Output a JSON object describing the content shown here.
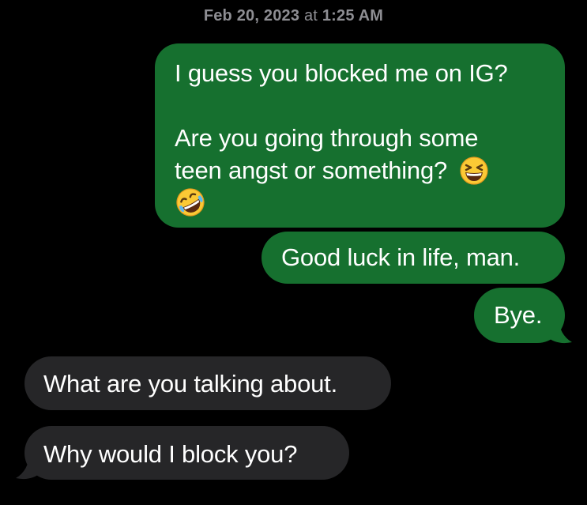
{
  "timestamp": {
    "date": "Feb 20, 2023",
    "connector": "at",
    "time": "1:25 AM"
  },
  "messages": [
    {
      "direction": "sent",
      "lines": [
        "I guess you blocked me on IG?",
        "",
        "Are you going through some",
        "teen angst or something?"
      ],
      "emojis": [
        "grinning-squinting-face",
        "rolling-on-floor-laughing-face"
      ]
    },
    {
      "direction": "sent",
      "text": "Good luck in life, man."
    },
    {
      "direction": "sent",
      "text": "Bye."
    },
    {
      "direction": "received",
      "text": "What are you talking about."
    },
    {
      "direction": "received",
      "text": "Why would I block you?"
    }
  ],
  "colors": {
    "background": "#000000",
    "sent_bubble": "#16702f",
    "received_bubble": "#262628",
    "timestamp_text": "#8e8e93",
    "message_text": "#ffffff"
  }
}
